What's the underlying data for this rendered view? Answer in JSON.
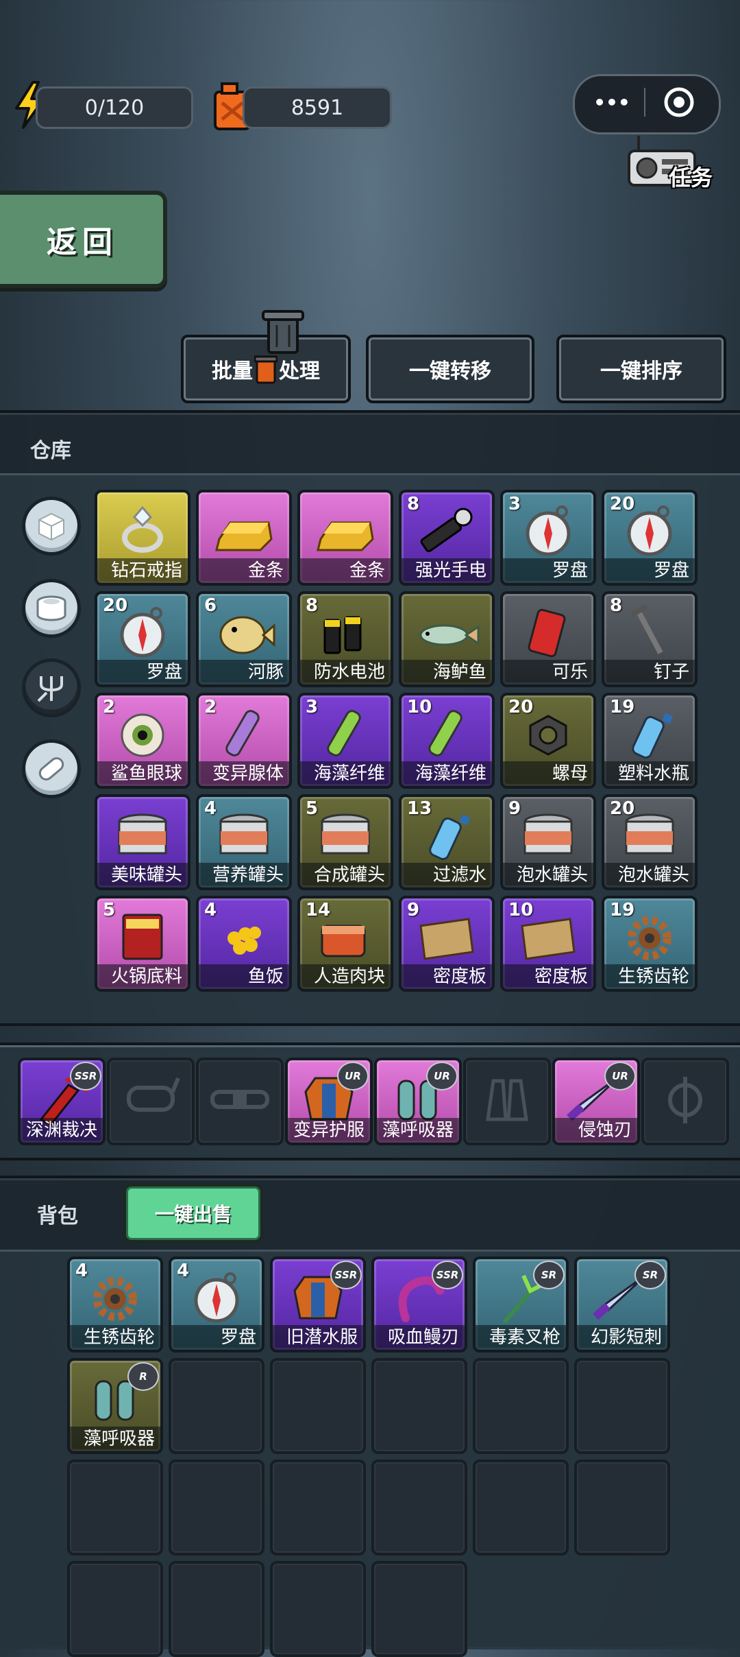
{
  "top": {
    "energy": "0/120",
    "fuel": "8591"
  },
  "capsule": {
    "more": "•••",
    "target": "◎"
  },
  "mission": {
    "label": "任务"
  },
  "back": {
    "label": "返回"
  },
  "actions": {
    "batch_pre": "批量",
    "batch_post": "处理",
    "transfer": "一键转移",
    "sort": "一键排序"
  },
  "warehouse": {
    "title": "仓库",
    "items": [
      {
        "name": "钻石戒指",
        "qty": "",
        "rarity": "yellow",
        "icon": "ring"
      },
      {
        "name": "金条",
        "qty": "",
        "rarity": "pink",
        "icon": "gold"
      },
      {
        "name": "金条",
        "qty": "",
        "rarity": "pink",
        "icon": "gold"
      },
      {
        "name": "强光手电",
        "qty": "8",
        "rarity": "purple",
        "icon": "flashlight"
      },
      {
        "name": "罗盘",
        "qty": "3",
        "rarity": "teal",
        "icon": "compass"
      },
      {
        "name": "罗盘",
        "qty": "20",
        "rarity": "teal",
        "icon": "compass"
      },
      {
        "name": "罗盘",
        "qty": "20",
        "rarity": "teal",
        "icon": "compass"
      },
      {
        "name": "河豚",
        "qty": "6",
        "rarity": "teal",
        "icon": "puffer"
      },
      {
        "name": "防水电池",
        "qty": "8",
        "rarity": "olive",
        "icon": "battery"
      },
      {
        "name": "海鲈鱼",
        "qty": "",
        "rarity": "olive",
        "icon": "fish"
      },
      {
        "name": "可乐",
        "qty": "",
        "rarity": "gray",
        "icon": "cola"
      },
      {
        "name": "钉子",
        "qty": "8",
        "rarity": "gray",
        "icon": "nail"
      },
      {
        "name": "鲨鱼眼球",
        "qty": "2",
        "rarity": "pink",
        "icon": "eye"
      },
      {
        "name": "变异腺体",
        "qty": "2",
        "rarity": "pink",
        "icon": "tube"
      },
      {
        "name": "海藻纤维",
        "qty": "3",
        "rarity": "purple",
        "icon": "tube-green"
      },
      {
        "name": "海藻纤维",
        "qty": "10",
        "rarity": "purple",
        "icon": "tube-green"
      },
      {
        "name": "螺母",
        "qty": "20",
        "rarity": "olive",
        "icon": "nut"
      },
      {
        "name": "塑料水瓶",
        "qty": "19",
        "rarity": "gray",
        "icon": "bottle"
      },
      {
        "name": "美味罐头",
        "qty": "",
        "rarity": "purple",
        "icon": "can"
      },
      {
        "name": "营养罐头",
        "qty": "4",
        "rarity": "teal",
        "icon": "can"
      },
      {
        "name": "合成罐头",
        "qty": "5",
        "rarity": "olive",
        "icon": "can"
      },
      {
        "name": "过滤水",
        "qty": "13",
        "rarity": "olive",
        "icon": "bottle"
      },
      {
        "name": "泡水罐头",
        "qty": "9",
        "rarity": "gray",
        "icon": "can"
      },
      {
        "name": "泡水罐头",
        "qty": "20",
        "rarity": "gray",
        "icon": "can"
      },
      {
        "name": "火锅底料",
        "qty": "5",
        "rarity": "pink",
        "icon": "hotpot"
      },
      {
        "name": "鱼饭",
        "qty": "4",
        "rarity": "purple",
        "icon": "roe"
      },
      {
        "name": "人造肉块",
        "qty": "14",
        "rarity": "olive",
        "icon": "meat"
      },
      {
        "name": "密度板",
        "qty": "9",
        "rarity": "purple",
        "icon": "board"
      },
      {
        "name": "密度板",
        "qty": "10",
        "rarity": "purple",
        "icon": "board"
      },
      {
        "name": "生锈齿轮",
        "qty": "19",
        "rarity": "teal",
        "icon": "gear"
      }
    ],
    "categories": [
      {
        "icon": "box-icon"
      },
      {
        "icon": "can-icon"
      },
      {
        "icon": "trident-icon"
      },
      {
        "icon": "pill-icon"
      }
    ]
  },
  "equipment": {
    "slots": [
      {
        "name": "深渊裁决",
        "rank": "SSR",
        "rarity": "purple",
        "icon": "weapon"
      },
      {
        "name": "",
        "rank": "",
        "rarity": "empty",
        "icon": "mask"
      },
      {
        "name": "",
        "rank": "",
        "rarity": "empty",
        "icon": "belt"
      },
      {
        "name": "变异护服",
        "rank": "UR",
        "rarity": "pink",
        "icon": "suit"
      },
      {
        "name": "藻呼吸器",
        "rank": "UR",
        "rarity": "pink",
        "icon": "tanks"
      },
      {
        "name": "",
        "rank": "",
        "rarity": "empty",
        "icon": "fins"
      },
      {
        "name": "侵蚀刃",
        "rank": "UR",
        "rarity": "pink",
        "icon": "knife"
      },
      {
        "name": "",
        "rank": "",
        "rarity": "empty",
        "icon": "phi"
      }
    ]
  },
  "backpack": {
    "title": "背包",
    "sell_all": "一键出售",
    "items": [
      {
        "name": "生锈齿轮",
        "qty": "4",
        "rank": "",
        "rarity": "teal",
        "icon": "gear"
      },
      {
        "name": "罗盘",
        "qty": "4",
        "rank": "",
        "rarity": "teal",
        "icon": "compass"
      },
      {
        "name": "旧潜水服",
        "qty": "",
        "rank": "SSR",
        "rarity": "purple",
        "icon": "suit"
      },
      {
        "name": "吸血鳗刃",
        "qty": "",
        "rank": "SSR",
        "rarity": "purple",
        "icon": "eel"
      },
      {
        "name": "毒素叉枪",
        "qty": "",
        "rank": "SR",
        "rarity": "teal",
        "icon": "trident"
      },
      {
        "name": "幻影短刺",
        "qty": "",
        "rank": "SR",
        "rarity": "teal",
        "icon": "knife"
      },
      {
        "name": "藻呼吸器",
        "qty": "",
        "rank": "R",
        "rarity": "olive",
        "icon": "tanks"
      }
    ]
  },
  "colors": {
    "accent_green": "#5fd495",
    "back_green": "#5b8f6e"
  }
}
